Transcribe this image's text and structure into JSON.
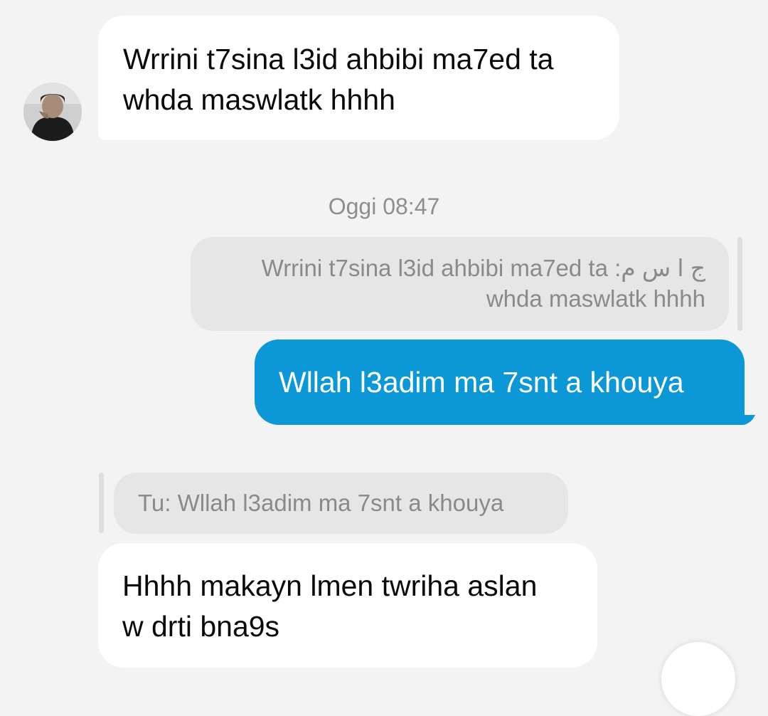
{
  "messages": {
    "incoming_1": {
      "line1": "Wrrini t7sina l3id ahbibi ma7ed ta",
      "line2": "whda maswlatk hhhh"
    },
    "timestamp": "Oggi 08:47",
    "reply_quote_right": {
      "prefix": "ج ا س م:",
      "line1": "Wrrini t7sina l3id ahbibi ma7ed ta",
      "line2": "whda maswlatk hhhh"
    },
    "outgoing_1": "Wllah l3adim ma 7snt a khouya",
    "reply_quote_left": "Tu: Wllah l3adim ma 7snt a khouya",
    "incoming_2": {
      "line1": "Hhhh makayn lmen twriha aslan",
      "line2": "w drti bna9s"
    }
  },
  "colors": {
    "background": "#f3f3f3",
    "incoming_bubble": "#ffffff",
    "outgoing_bubble": "#0c97d6",
    "quote_bubble": "#e6e6e6",
    "meta_text": "#8e8e8e"
  }
}
